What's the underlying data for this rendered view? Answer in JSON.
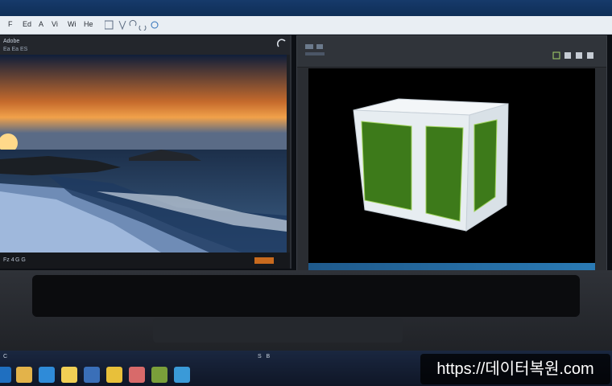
{
  "window": {
    "menu_items": [
      "F",
      "Ed",
      "A",
      "Vi",
      "Wi",
      "He"
    ],
    "toolbar_icons": [
      "select-icon",
      "move-icon",
      "undo-icon",
      "redo-icon",
      "zoom-icon"
    ]
  },
  "left_panel": {
    "header_text": "Adobe",
    "header_sub": "Ea  Ea  ES",
    "corner_icon": "minimize-icon",
    "footer_text": "Fz 4 G  G"
  },
  "right_panel": {
    "header_controls": [
      "menu-icon",
      "view-icon",
      "grid-icon",
      "close-icon"
    ]
  },
  "taskbar": {
    "left_text": "C        ",
    "right_text": "S   B",
    "icons": [
      "start-icon",
      "folder-icon",
      "browser-icon",
      "file-icon",
      "mail-icon",
      "photo-icon",
      "gallery-icon",
      "media-icon",
      "edge-icon"
    ]
  },
  "watermark": {
    "text": "https://데이터복원.com"
  },
  "colors": {
    "accent": "#1f6fc0",
    "cube_green": "#3d7a1a",
    "cube_frame": "#e8eef2"
  }
}
